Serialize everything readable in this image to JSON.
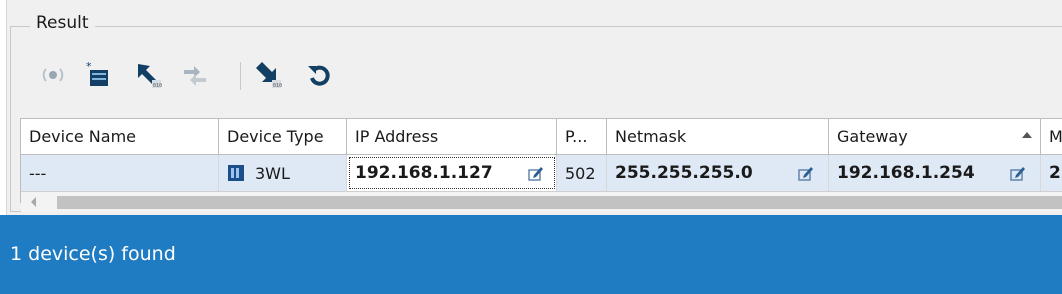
{
  "group": {
    "title": "Result"
  },
  "toolbar": {
    "buttons": [
      {
        "name": "broadcast-icon"
      },
      {
        "name": "configure-device-icon"
      },
      {
        "name": "upload-icon"
      },
      {
        "name": "transfer-icon"
      },
      {
        "name": "download-icon"
      },
      {
        "name": "refresh-icon"
      }
    ]
  },
  "grid": {
    "columns": [
      "Device Name",
      "Device Type",
      "IP Address",
      "P...",
      "Netmask",
      "Gateway",
      "M"
    ],
    "sort_column": "Gateway",
    "rows": [
      {
        "device_name": "---",
        "device_type": "3WL",
        "ip_address": "192.168.1.127",
        "port": "502",
        "netmask": "255.255.255.0",
        "gateway": "192.168.1.254",
        "extra": "2"
      }
    ]
  },
  "status": {
    "text": "1 device(s) found"
  },
  "colors": {
    "status_bar": "#1f7bc2",
    "selection": "#dfe8f5"
  }
}
